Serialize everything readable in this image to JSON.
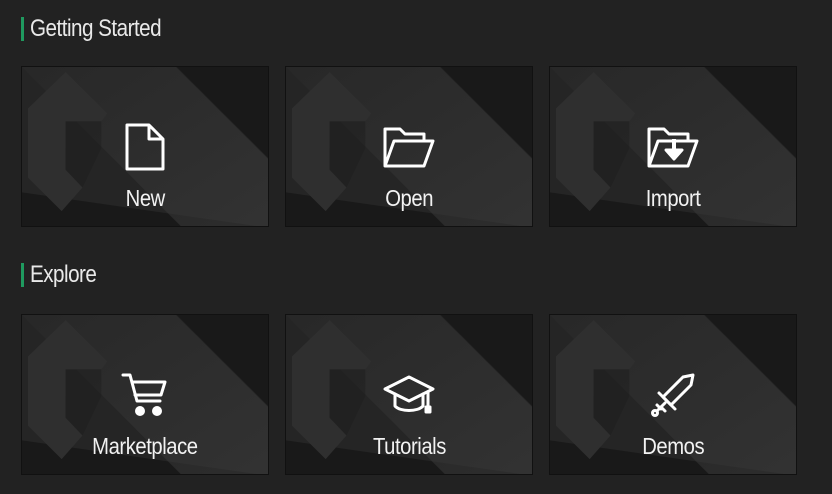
{
  "sections": [
    {
      "title": "Getting Started",
      "cards": [
        {
          "label": "New",
          "icon": "file-icon"
        },
        {
          "label": "Open",
          "icon": "folder-open-icon"
        },
        {
          "label": "Import",
          "icon": "folder-import-icon"
        }
      ]
    },
    {
      "title": "Explore",
      "cards": [
        {
          "label": "Marketplace",
          "icon": "cart-icon"
        },
        {
          "label": "Tutorials",
          "icon": "graduation-cap-icon"
        },
        {
          "label": "Demos",
          "icon": "sword-icon"
        }
      ]
    }
  ],
  "colors": {
    "background": "#222222",
    "accent": "#1f9a5f",
    "card": "#1a1a1a",
    "text": "#f2f2f2"
  }
}
